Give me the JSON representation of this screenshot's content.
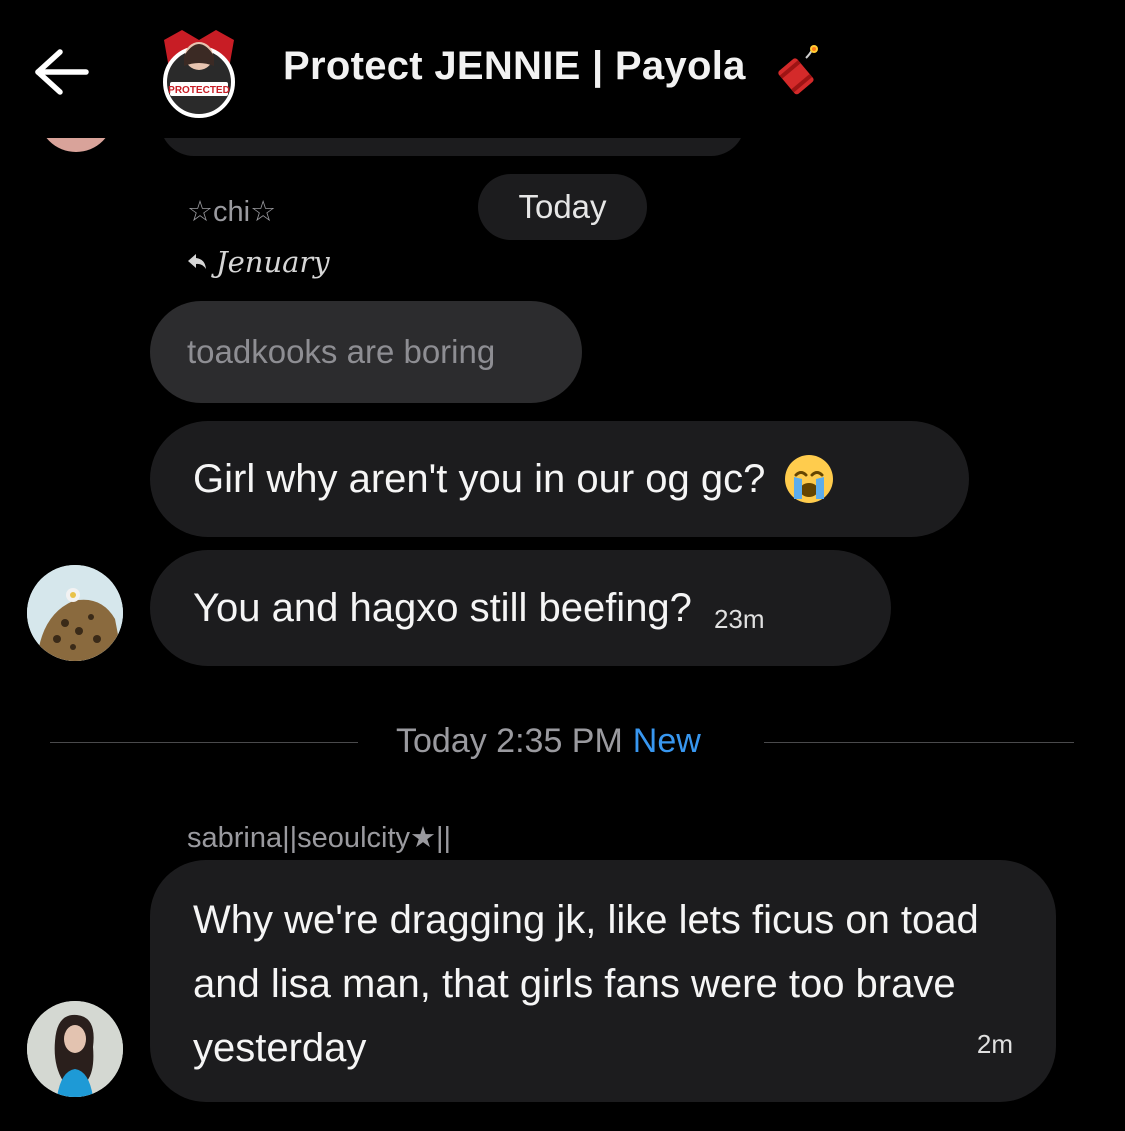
{
  "header": {
    "title": "Protect JENNIE | Payola",
    "avatar_badge_text": "PROTECTED"
  },
  "thread": {
    "top_sender": "☆chi☆",
    "date_chip": "Today",
    "reply_to": {
      "name": "Jenuary",
      "quoted_text": "toadkooks are boring"
    },
    "messages_chi": [
      {
        "text": "Girl why aren't you in our og gc?",
        "emoji": "loudly-crying-face"
      },
      {
        "text": "You and hagxo still beefing?",
        "time": "23m"
      }
    ],
    "divider": {
      "label": "Today 2:35 PM",
      "new_label": "New"
    },
    "second_sender": "sabrina||seoulcity★||",
    "message_sabrina": {
      "text": "Why we're dragging jk, like lets ficus on toad and lisa man, that girls fans were too brave yesterday",
      "time": "2m"
    }
  },
  "colors": {
    "background": "#000000",
    "bubble": "#1c1c1e",
    "quoted_bubble": "#2c2c2e",
    "accent_new": "#3897f0"
  },
  "icons": [
    "back-arrow-icon",
    "firecracker-icon",
    "reply-arrow-icon",
    "crying-face-emoji"
  ]
}
